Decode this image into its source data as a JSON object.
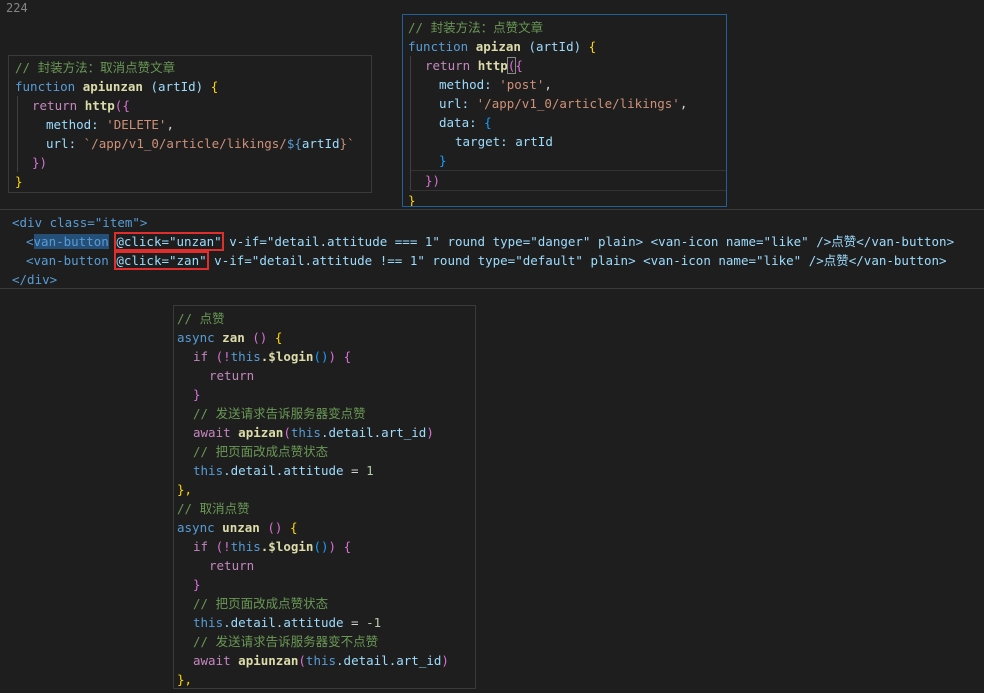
{
  "editor": {
    "line_number": "224"
  },
  "unzan_api": {
    "comment": "// 封装方法：取消点赞文章",
    "kw_function": "function",
    "name": "apiunzan",
    "params": "(artId)",
    "brace_open": "{",
    "kw_return": "return",
    "call": "http",
    "method_key": "method:",
    "method_value": "'DELETE'",
    "url_key": "url:",
    "url_value_start": "`/app/v1_0/article/likings/",
    "url_interp_open": "${",
    "url_interp_var": "artId",
    "url_interp_close": "}`",
    "close_call": "})",
    "close_fn": "}",
    "cut_line": "// 封装方法：点赞文章"
  },
  "zan_api": {
    "comment": "// 封装方法：点赞文章",
    "kw_function": "function",
    "name": "apizan",
    "params": "(artId)",
    "brace_open": "{",
    "kw_return": "return",
    "call": "http",
    "method_key": "method:",
    "method_value": "'post'",
    "url_key": "url:",
    "url_value": "'/app/v1_0/article/likings'",
    "data_key": "data:",
    "target_key": "target:",
    "target_value": "artId",
    "close_data": "}",
    "close_call": "})",
    "close_fn": "}"
  },
  "template": {
    "div_open": "<div class=\"item\">",
    "line1": {
      "tag": "van-button",
      "click": "@click=\"unzan\"",
      "rest": " v-if=\"detail.attitude === 1\" round type=\"danger\" plain> <van-icon name=\"like\" />点赞</van-button>"
    },
    "line2": {
      "tag": "van-button",
      "click": "@click=\"zan\"",
      "rest": " v-if=\"detail.attitude !== 1\" round type=\"default\" plain> <van-icon name=\"like\" />点赞</van-button>"
    },
    "div_close": "</div>"
  },
  "methods": {
    "zan_comment": "// 点赞",
    "kw_async": "async",
    "zan_name": "zan",
    "empty_params": "()",
    "brace_open": "{",
    "kw_if": "if",
    "login_check_prefix": "(!",
    "this_kw": "this",
    "login_fn": ".$login",
    "login_call": "()",
    "login_check_suffix": ")",
    "kw_return": "return",
    "close_if": "}",
    "send_zan_comment": "// 发送请求告诉服务器变点赞",
    "kw_await": "await",
    "apizan_call": "apizan",
    "art_id_arg": ".detail.art_id",
    "change_state_comment": "// 把页面改成点赞状态",
    "attitude_prop": ".detail.attitude",
    "assign": " = ",
    "zan_value": "1",
    "method_close": "},",
    "unzan_comment": "// 取消点赞",
    "unzan_name": "unzan",
    "unzan_value": "-1",
    "send_unzan_comment": "// 发送请求告诉服务器变不点赞",
    "apiunzan_call": "apiunzan"
  }
}
